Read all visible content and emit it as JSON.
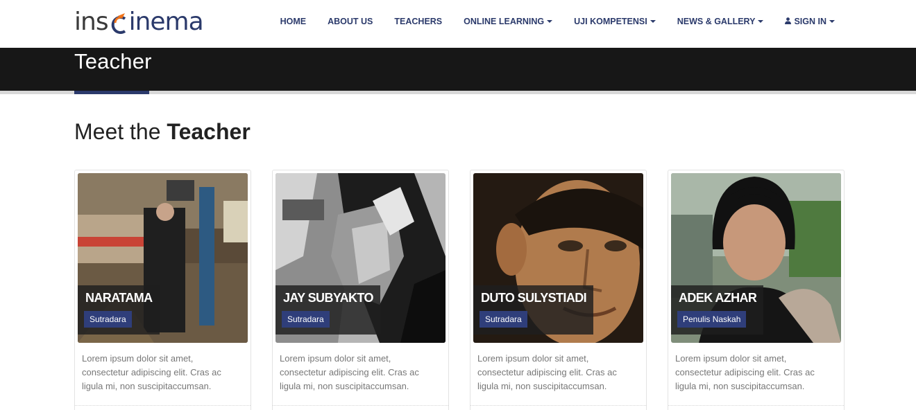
{
  "brand": {
    "logo_left": "ins",
    "logo_right": "inema",
    "accent": "#f0731a",
    "primary": "#2b3a6b"
  },
  "nav": {
    "items": [
      {
        "label": "HOME",
        "dropdown": false
      },
      {
        "label": "ABOUT US",
        "dropdown": false
      },
      {
        "label": "TEACHERS",
        "dropdown": false
      },
      {
        "label": "ONLINE LEARNING",
        "dropdown": true
      },
      {
        "label": "UJI KOMPETENSI",
        "dropdown": true
      },
      {
        "label": "NEWS & GALLERY",
        "dropdown": true
      },
      {
        "label": "SIGN IN",
        "dropdown": true,
        "icon": "user-icon"
      }
    ]
  },
  "page": {
    "title": "Teacher"
  },
  "section": {
    "heading_light": "Meet the ",
    "heading_bold": "Teacher"
  },
  "teachers": [
    {
      "name": "NARATAMA",
      "role": "Sutradara",
      "description": "Lorem ipsum dolor sit amet, consectetur adipiscing elit. Cras ac ligula mi, non suscipitaccumsan."
    },
    {
      "name": "JAY SUBYAKTO",
      "role": "Sutradara",
      "description": "Lorem ipsum dolor sit amet, consectetur adipiscing elit. Cras ac ligula mi, non suscipitaccumsan."
    },
    {
      "name": "DUTO SULYSTIADI",
      "role": "Sutradara",
      "description": "Lorem ipsum dolor sit amet, consectetur adipiscing elit. Cras ac ligula mi, non suscipitaccumsan."
    },
    {
      "name": "ADEK AZHAR",
      "role": "Penulis Naskah",
      "description": "Lorem ipsum dolor sit amet, consectetur adipiscing elit. Cras ac ligula mi, non suscipitaccumsan."
    }
  ]
}
